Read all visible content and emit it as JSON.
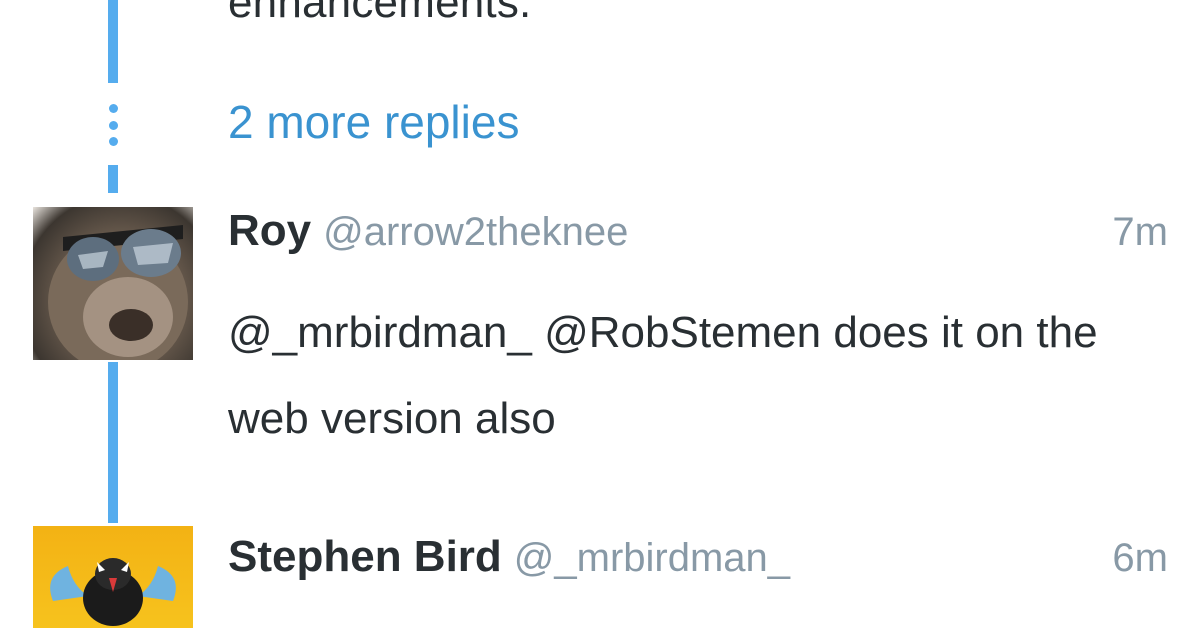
{
  "thread": {
    "previous_text": "enhancements.",
    "more_replies_label": "2 more replies"
  },
  "tweets": [
    {
      "display_name": "Roy",
      "handle": "@arrow2theknee",
      "time": "7m",
      "text": "@_mrbirdman_ @RobStemen does it on the web version also",
      "avatar": "sloth-with-sunglasses-avatar"
    },
    {
      "display_name": "Stephen Bird",
      "handle": "@_mrbirdman_",
      "time": "6m",
      "text": "",
      "avatar": "cartoon-bird-avatar"
    }
  ],
  "colors": {
    "thread_line": "#55acee",
    "link": "#3a93d0",
    "text": "#292f33",
    "muted": "#8899a6"
  }
}
